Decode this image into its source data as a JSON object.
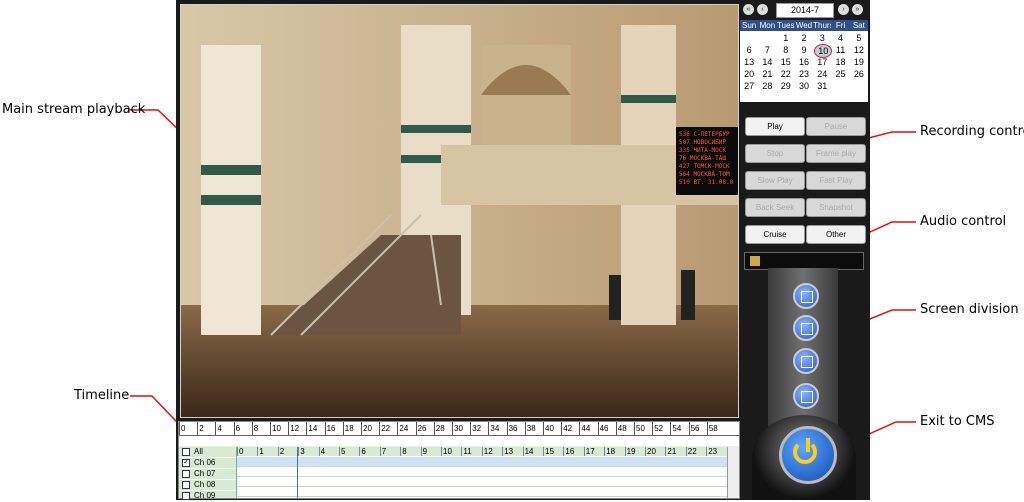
{
  "callouts": {
    "main_stream": "Main stream playback",
    "timeline": "Timeline",
    "recording": "Recording control",
    "audio": "Audio control",
    "screen_div": "Screen division",
    "exit": "Exit to CMS"
  },
  "timeline": {
    "ruler": [
      "0",
      "2",
      "4",
      "6",
      "8",
      "10",
      "12",
      "14",
      "16",
      "18",
      "20",
      "22",
      "24",
      "26",
      "28",
      "30",
      "32",
      "34",
      "36",
      "38",
      "40",
      "42",
      "44",
      "46",
      "48",
      "50",
      "52",
      "54",
      "56",
      "58"
    ],
    "hours": [
      "0",
      "1",
      "2",
      "3",
      "4",
      "5",
      "6",
      "7",
      "8",
      "9",
      "10",
      "11",
      "12",
      "13",
      "14",
      "15",
      "16",
      "17",
      "18",
      "19",
      "20",
      "21",
      "22",
      "23"
    ],
    "channels": [
      {
        "label": "All",
        "checked": false
      },
      {
        "label": "Ch 06",
        "checked": true
      },
      {
        "label": "Ch 07",
        "checked": false
      },
      {
        "label": "Ch 08",
        "checked": false
      },
      {
        "label": "Ch 09",
        "checked": false
      }
    ]
  },
  "calendar": {
    "month": "2014-7",
    "nav": [
      "«",
      "‹",
      "›",
      "»"
    ],
    "headers": [
      "Sun",
      "Mon",
      "Tues",
      "Wed",
      "Thurs",
      "Fri",
      "Sat"
    ],
    "weeks": [
      [
        "",
        "",
        "1",
        "2",
        "3",
        "4",
        "5"
      ],
      [
        "6",
        "7",
        "8",
        "9",
        "10",
        "11",
        "12"
      ],
      [
        "13",
        "14",
        "15",
        "16",
        "17",
        "18",
        "19"
      ],
      [
        "20",
        "21",
        "22",
        "23",
        "24",
        "25",
        "26"
      ],
      [
        "27",
        "28",
        "29",
        "30",
        "31",
        "",
        ""
      ]
    ],
    "today": "10"
  },
  "controls": {
    "play": "Play",
    "pause": "Pause",
    "stop": "Stop",
    "frame": "Frame play",
    "slow": "Slow Play",
    "fast": "Fast Play",
    "back": "Back Seek",
    "snapshot": "Snapshot",
    "cruise": "Cruise",
    "other": "Other"
  },
  "led": [
    "536  C-ПЕТЕРБУР",
    "507  НОВОСИБИР",
    "335  ЧИТА-МОСК",
    "76   МОСКВА-ТАШ",
    "427  ТОМСК-МОСК",
    "564  МОСКВА-ТОМ",
    "510 ВТ. 31.08.0"
  ]
}
